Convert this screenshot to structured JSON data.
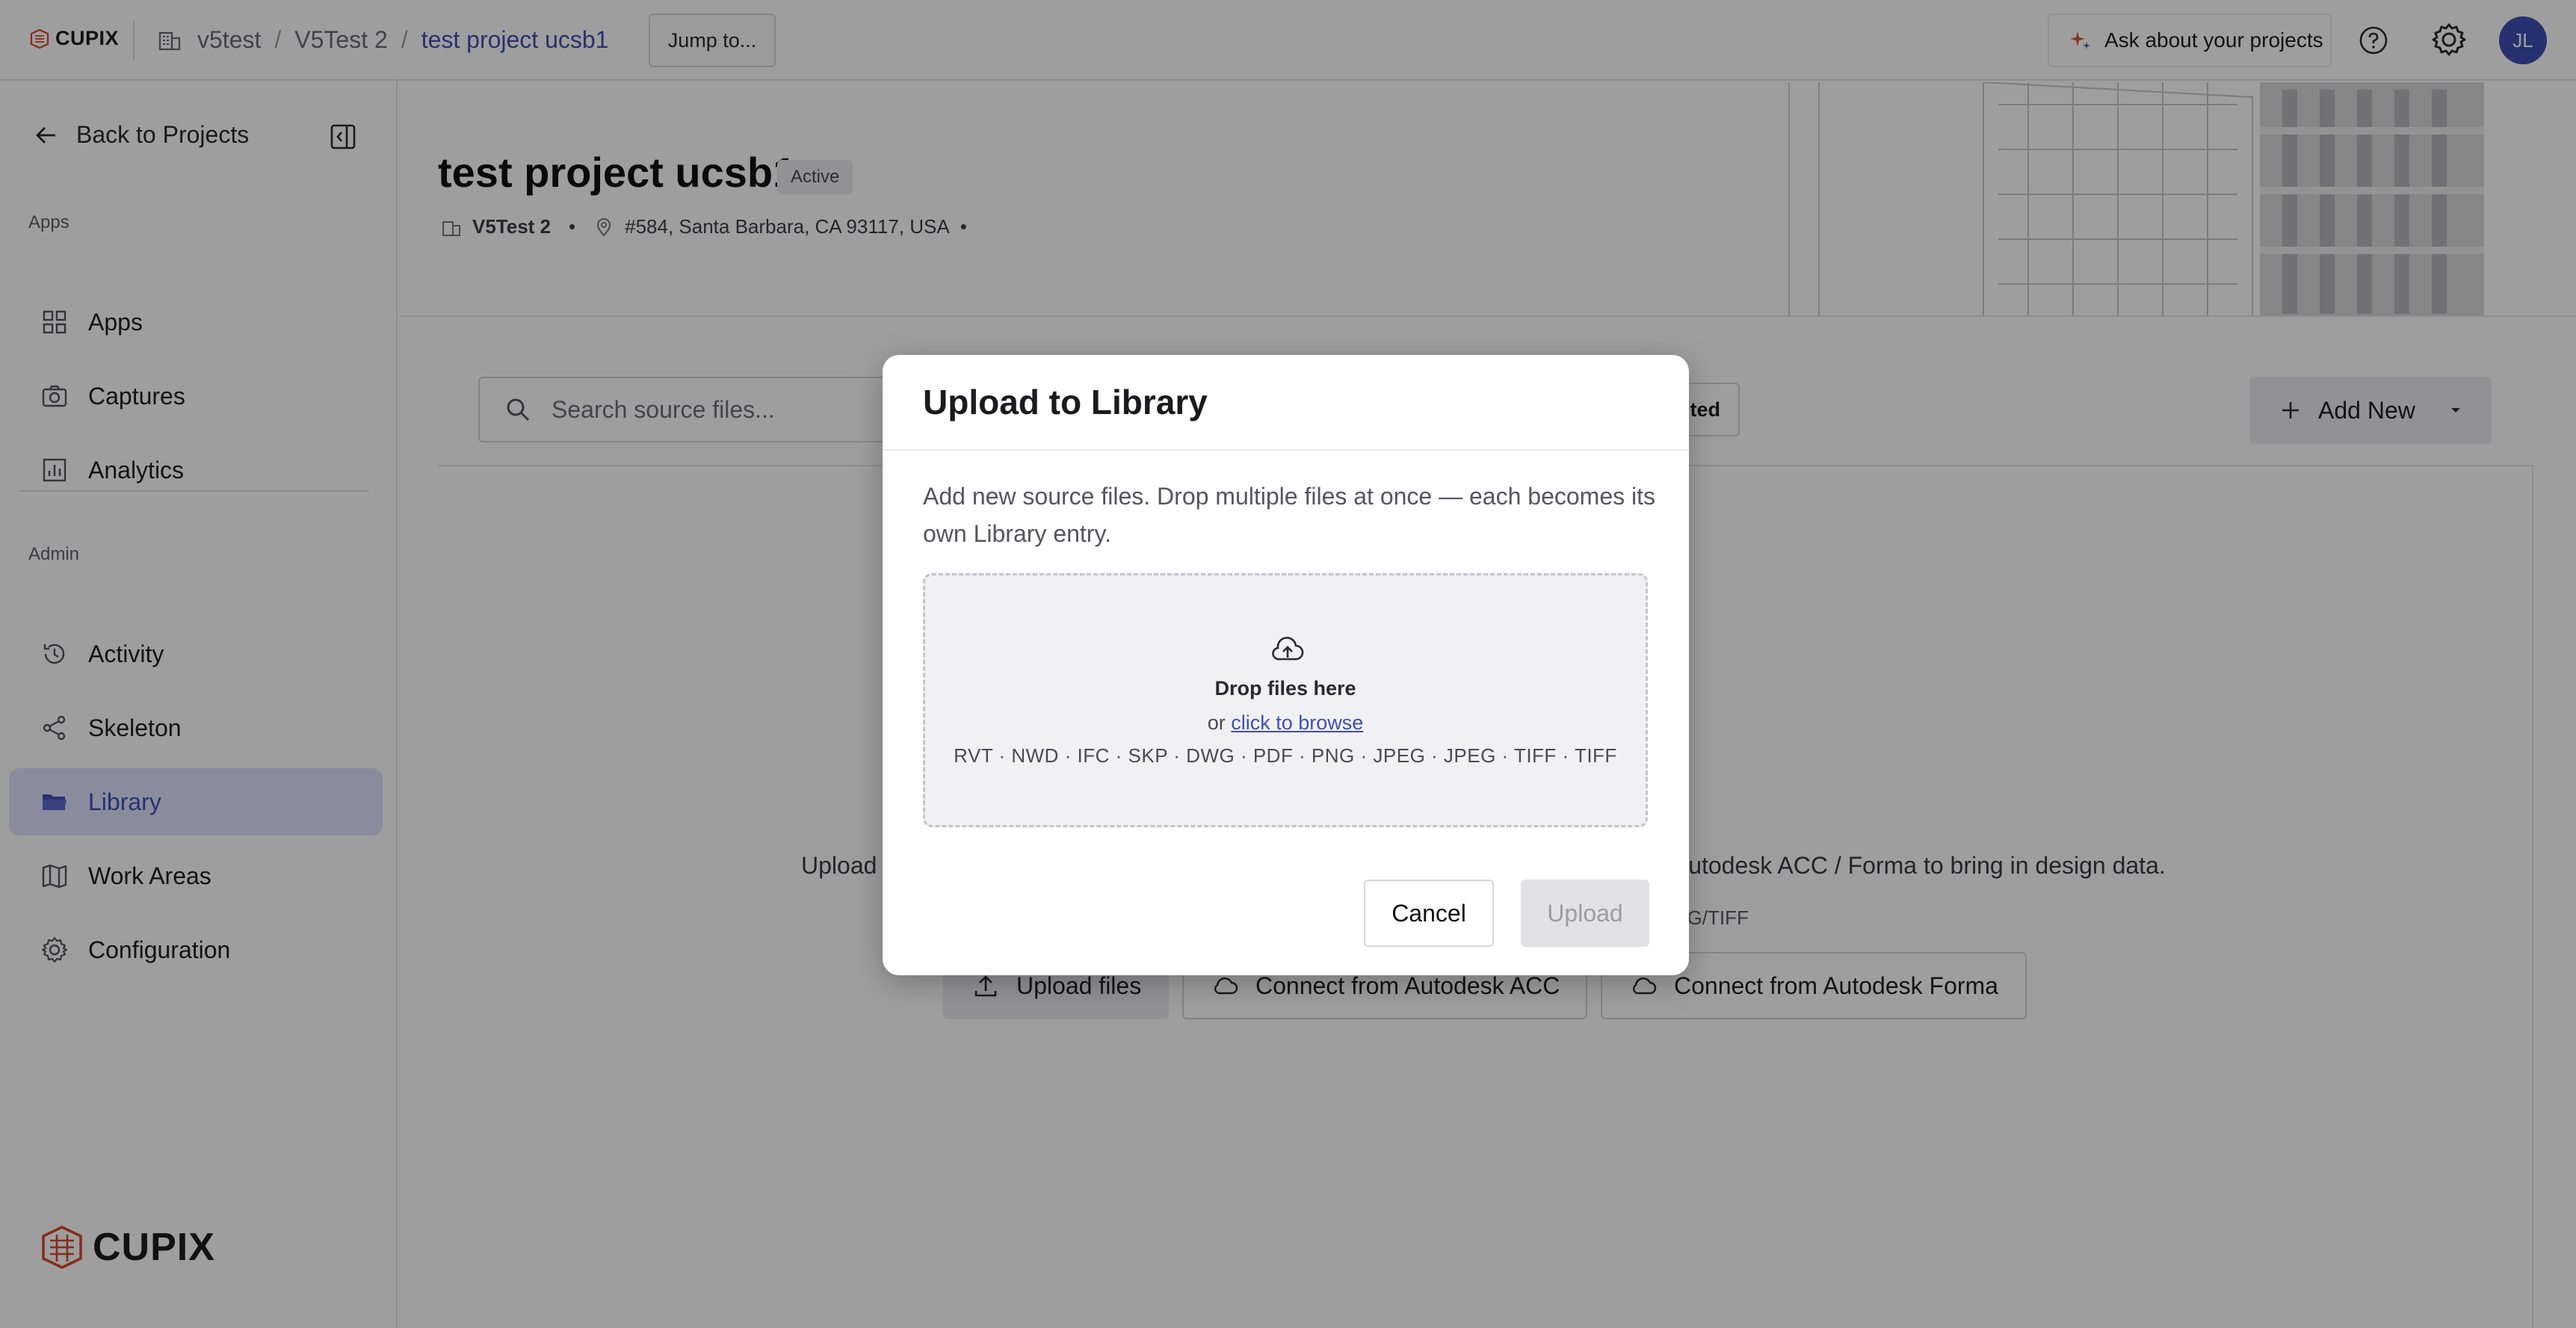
{
  "topbar": {
    "logo_text": "CUPIX",
    "breadcrumbs": [
      "v5test",
      "V5Test 2",
      "test project ucsb1"
    ],
    "separator": "/",
    "jump_label": "Jump to...",
    "ask_label": "Ask about your projects",
    "avatar_initials": "JL",
    "accent_color": "#3f4fb5"
  },
  "sidebar": {
    "back_label": "Back to Projects",
    "apps_section": "Apps",
    "admin_section": "Admin",
    "apps_items": [
      {
        "label": "Apps",
        "icon": "grid-icon"
      },
      {
        "label": "Captures",
        "icon": "camera-icon"
      },
      {
        "label": "Analytics",
        "icon": "chart-icon"
      }
    ],
    "admin_items": [
      {
        "label": "Activity",
        "icon": "history-icon"
      },
      {
        "label": "Skeleton",
        "icon": "skeleton-icon"
      },
      {
        "label": "Library",
        "icon": "folder-icon",
        "active": true
      },
      {
        "label": "Work Areas",
        "icon": "map-icon"
      },
      {
        "label": "Configuration",
        "icon": "gear-icon"
      }
    ],
    "footer_logo": "CUPIX"
  },
  "project": {
    "title": "test project ucsb1",
    "status": "Active",
    "org": "V5Test 2",
    "address": "#584, Santa Barbara, CA 93117, USA",
    "bullet": "•"
  },
  "library": {
    "search_placeholder": "Search source files...",
    "filter_label": "nted",
    "add_new_label": "Add New",
    "empty_desc_left": "Upload",
    "empty_desc_right": "utodesk ACC / Forma to bring in design data.",
    "empty_formats_tail": "EG/TIFF",
    "upload_files_label": "Upload files",
    "connect_acc_label": "Connect from Autodesk ACC",
    "connect_forma_label": "Connect from Autodesk Forma"
  },
  "modal": {
    "title": "Upload to Library",
    "description": "Add new source files. Drop multiple files at once — each becomes its own Library entry.",
    "drop_title": "Drop files here",
    "browse_prefix": "or",
    "browse_link": "click to browse",
    "formats": "RVT · NWD · IFC · SKP · DWG · PDF · PNG · JPEG · JPEG · TIFF · TIFF",
    "cancel_label": "Cancel",
    "upload_label": "Upload"
  }
}
